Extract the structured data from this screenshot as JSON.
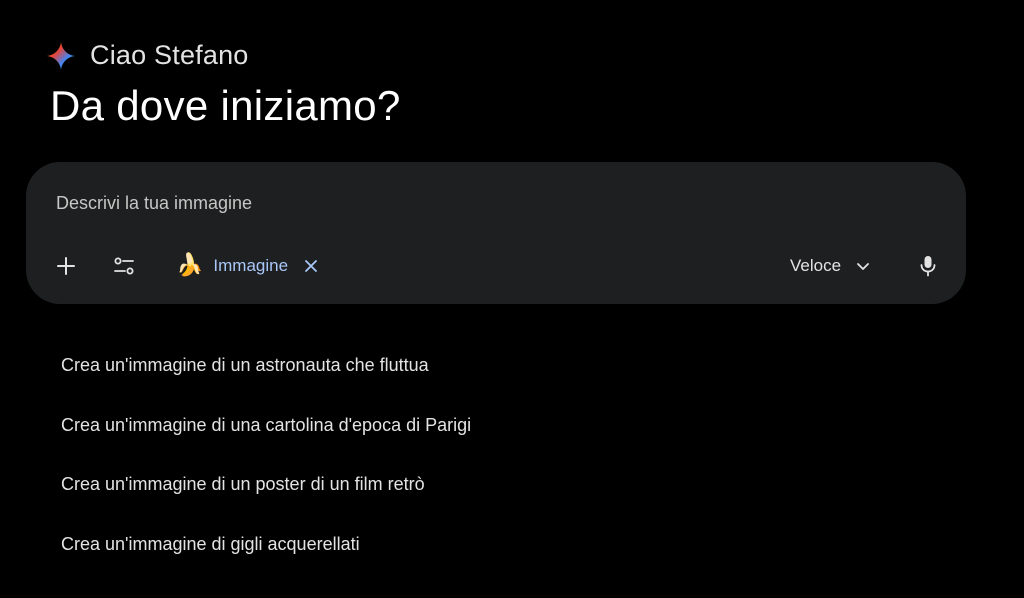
{
  "greeting": {
    "text": "Ciao Stefano",
    "icon": "gemini-spark-icon"
  },
  "headline": "Da dove iniziamo?",
  "composer": {
    "placeholder": "Descrivi la tua immagine",
    "value": "",
    "add_icon": "plus-icon",
    "tools_icon": "tools-sliders-icon",
    "chip": {
      "emoji": "🍌",
      "label": "Immagine",
      "close_icon": "close-icon"
    },
    "model": {
      "selected": "Veloce",
      "icon": "chevron-down-icon"
    },
    "mic_icon": "microphone-icon"
  },
  "suggestions": [
    {
      "label": "Crea un'immagine di un astronauta che fluttua"
    },
    {
      "label": "Crea un'immagine di una cartolina d'epoca di Parigi"
    },
    {
      "label": "Crea un'immagine di un poster di un film retrò"
    },
    {
      "label": "Crea un'immagine di gigli acquerellati"
    }
  ],
  "colors": {
    "background": "#000000",
    "composer_bg": "#1e1f20",
    "accent": "#a8c7fa",
    "text": "#e3e3e3"
  }
}
